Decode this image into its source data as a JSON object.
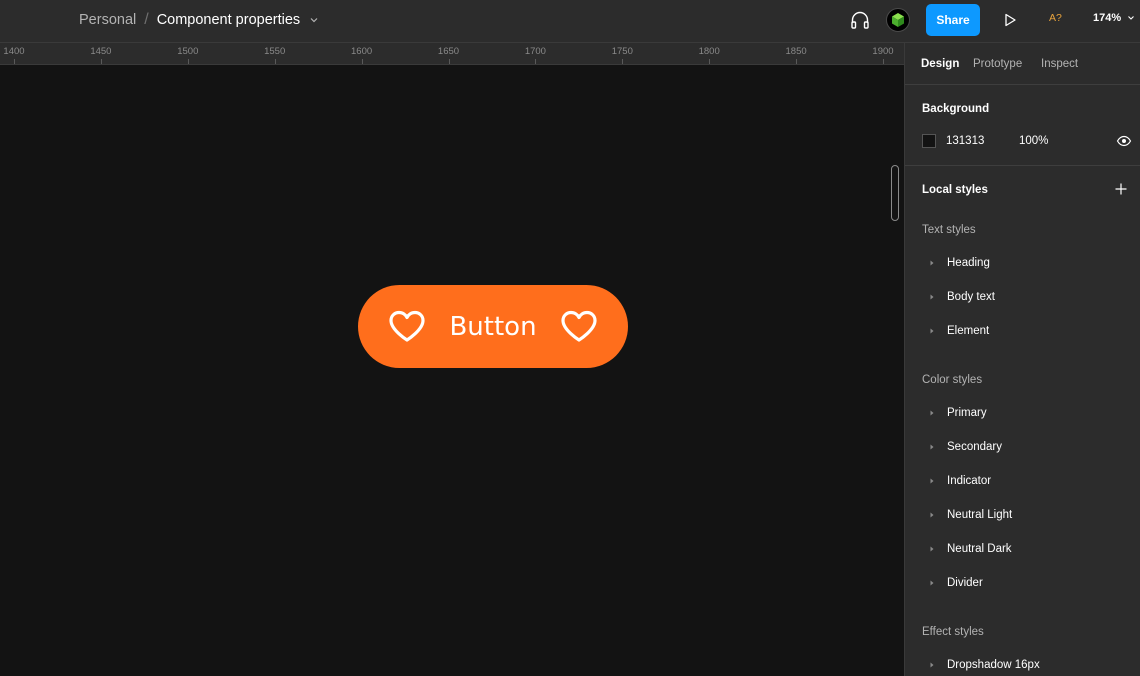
{
  "topbar": {
    "breadcrumb_team": "Personal",
    "breadcrumb_separator": "/",
    "file_title": "Component properties",
    "share_label": "Share",
    "missing_fonts_label": "A?",
    "zoom_label": "174%"
  },
  "ruler": {
    "ticks": [
      "1400",
      "1450",
      "1500",
      "1550",
      "1600",
      "1650",
      "1700",
      "1750",
      "1800",
      "1850",
      "1900"
    ]
  },
  "canvas": {
    "button_label": "Button",
    "button_color": "#ff6e1c",
    "background_color": "#131313"
  },
  "panel": {
    "tabs": [
      {
        "label": "Design",
        "active": true
      },
      {
        "label": "Prototype",
        "active": false
      },
      {
        "label": "Inspect",
        "active": false
      }
    ],
    "background": {
      "title": "Background",
      "hex": "131313",
      "opacity": "100%"
    },
    "local_styles": {
      "title": "Local styles",
      "text_styles": {
        "title": "Text styles",
        "items": [
          "Heading",
          "Body text",
          "Element"
        ]
      },
      "color_styles": {
        "title": "Color styles",
        "items": [
          "Primary",
          "Secondary",
          "Indicator",
          "Neutral Light",
          "Neutral Dark",
          "Divider"
        ]
      },
      "effect_styles": {
        "title": "Effect styles",
        "items": [
          "Dropshadow 16px"
        ]
      }
    }
  },
  "colors": {
    "accent": "#0d99ff",
    "warning": "#e8a33d",
    "panel_bg": "#2c2c2c"
  }
}
